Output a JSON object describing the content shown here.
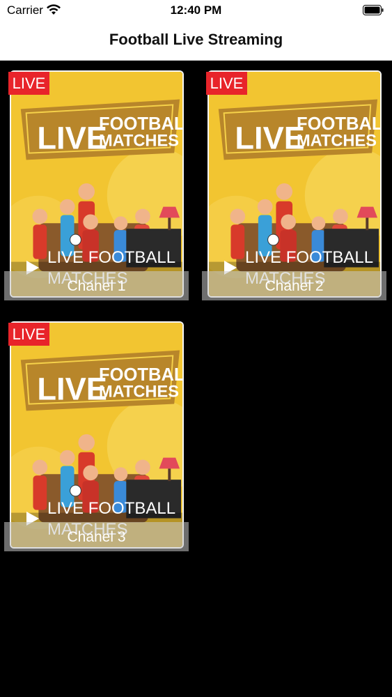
{
  "status_bar": {
    "carrier": "Carrier",
    "time": "12:40 PM",
    "wifi_icon": "wifi-icon",
    "battery_icon": "battery-icon"
  },
  "nav": {
    "title": "Football Live Streaming"
  },
  "thumbnail": {
    "banner_big": "LIVE",
    "banner_word1": "FOOTBALL",
    "banner_word2": "MATCHES"
  },
  "channels": [
    {
      "badge": "LIVE",
      "video_title": "LIVE FOOTBALL MATCHES",
      "caption": "Chanel 1"
    },
    {
      "badge": "LIVE",
      "video_title": "LIVE FOOTBALL MATCHES",
      "caption": "Chanel 2"
    },
    {
      "badge": "LIVE",
      "video_title": "LIVE FOOTBALL MATCHES",
      "caption": "Chanel 3"
    }
  ],
  "colors": {
    "badge_red": "#e8242a",
    "poster_yellow": "#f2c531",
    "banner_brown": "#b8862a"
  }
}
